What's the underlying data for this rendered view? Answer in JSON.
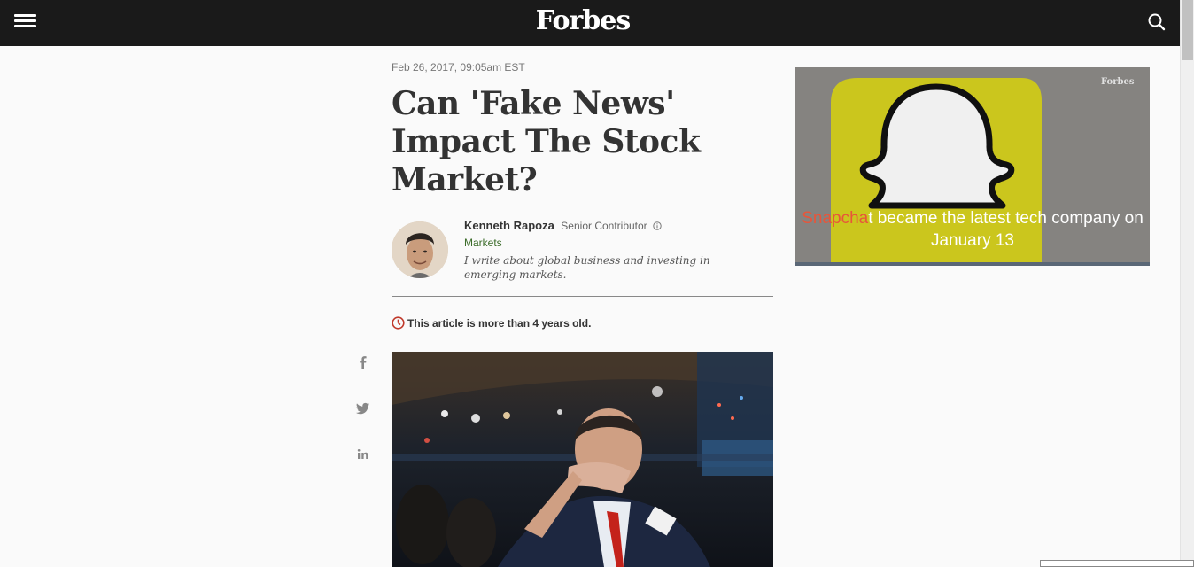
{
  "header": {
    "logo": "Forbes",
    "menu_icon": "hamburger-menu-icon",
    "search_icon": "search-icon",
    "background": "#1a1a1a"
  },
  "article": {
    "date": "Feb 26, 2017, 09:05am EST",
    "title": "Can 'Fake News' Impact The Stock Market?",
    "author": {
      "name": "Kenneth Rapoza",
      "role": "Senior Contributor",
      "section": "Markets",
      "bio": "I write about global business and investing in emerging markets."
    },
    "age_notice": "This article is more than 4 years old.",
    "age_notice_color": "#c0392b"
  },
  "share": {
    "facebook_icon": "facebook-icon",
    "twitter_icon": "twitter-icon",
    "linkedin_icon": "linkedin-icon"
  },
  "ad_video": {
    "watermark": "Forbes",
    "caption_highlight": "Snapcha",
    "caption_rest": "t became the latest tech company on January 13"
  }
}
